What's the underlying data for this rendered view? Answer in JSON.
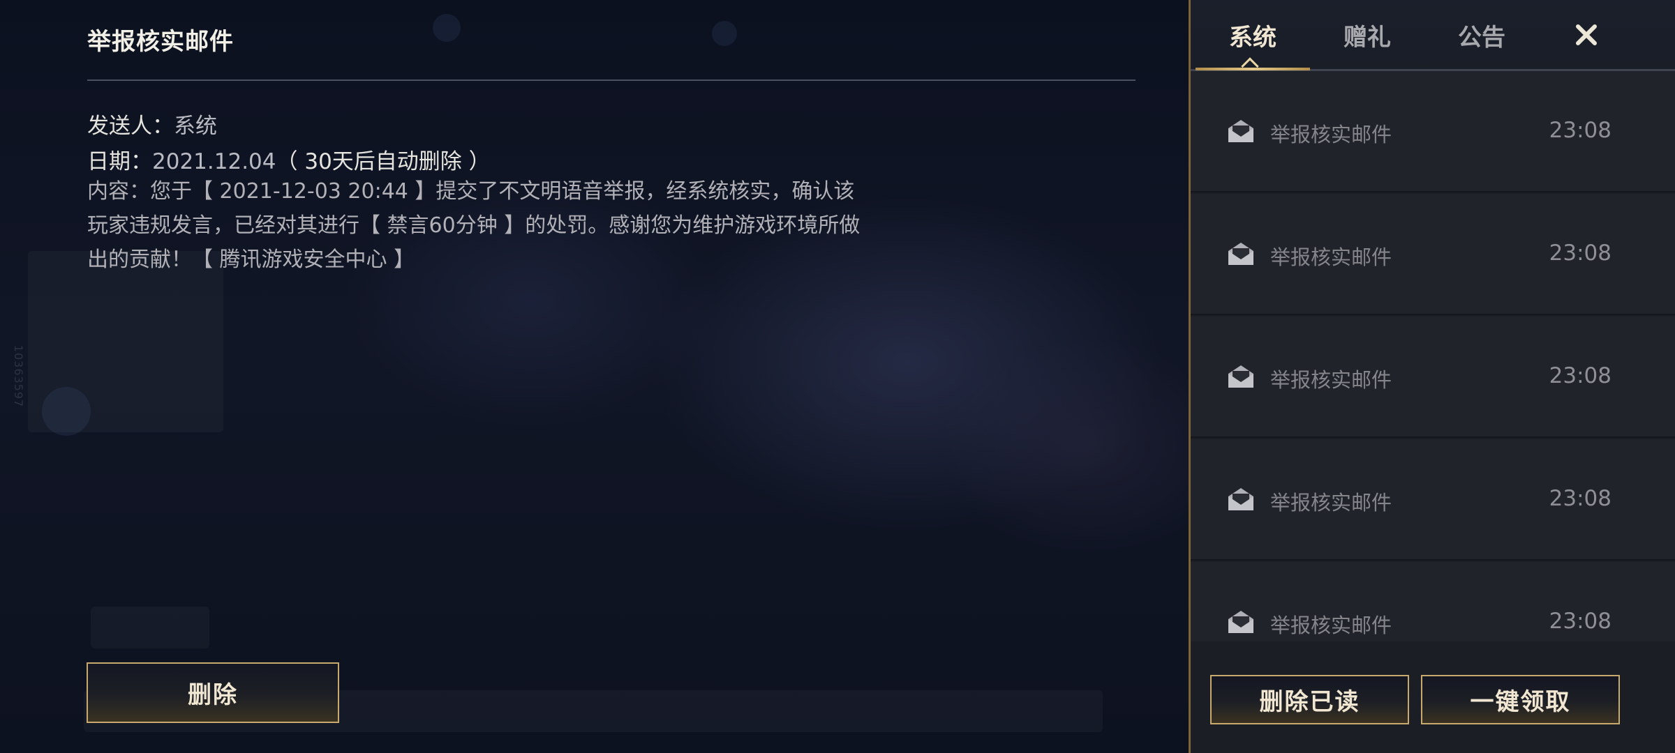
{
  "side_id": "10363597",
  "detail": {
    "title": "举报核实邮件",
    "sender_label": "发送人：",
    "sender_value": "系统",
    "date_label": "日期：",
    "date_value": "2021.12.04",
    "date_note": "（ 30天后自动删除 ）",
    "content": "内容：您于【 2021-12-03 20:44 】提交了不文明语音举报，经系统核实，确认该玩家违规发言，已经对其进行【 禁言60分钟 】的处罚。感谢您为维护游戏环境所做出的贡献！【 腾讯游戏安全中心 】",
    "delete_label": "删除"
  },
  "tabs": [
    {
      "label": "系统",
      "active": true
    },
    {
      "label": "赠礼",
      "active": false
    },
    {
      "label": "公告",
      "active": false
    }
  ],
  "close_icon": "close-icon",
  "mails": [
    {
      "title": "举报核实邮件",
      "time": "23:08",
      "icon": "envelope-open-icon"
    },
    {
      "title": "举报核实邮件",
      "time": "23:08",
      "icon": "envelope-open-icon"
    },
    {
      "title": "举报核实邮件",
      "time": "23:08",
      "icon": "envelope-open-icon"
    },
    {
      "title": "举报核实邮件",
      "time": "23:08",
      "icon": "envelope-open-icon"
    },
    {
      "title": "举报核实邮件",
      "time": "23:08",
      "icon": "envelope-open-icon"
    }
  ],
  "footer": {
    "delete_read_label": "删除已读",
    "claim_all_label": "一键领取"
  },
  "colors": {
    "gold_border": "#c8aa6e",
    "gold_text": "#f0e6d2",
    "panel_bg": "#1b1e25",
    "tab_underline": "#c9a860"
  }
}
